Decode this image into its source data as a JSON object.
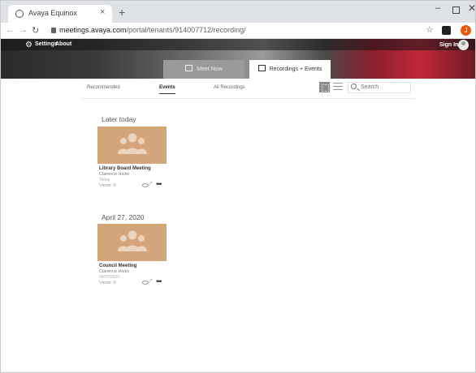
{
  "browser": {
    "tab_title": "Avaya Equinox",
    "close_glyph": "×",
    "new_tab_glyph": "+",
    "url_host": "meetings.avaya.com",
    "url_path": "/portal/tenants/914007712/recording/",
    "profile_initial": "J",
    "min_glyph": "–",
    "close_window_glyph": "✕"
  },
  "header": {
    "settings": "Settings",
    "about": "About",
    "sign_in": "Sign In"
  },
  "main_tabs": [
    {
      "label": "Meet Now"
    },
    {
      "label": "Recordings + Events"
    }
  ],
  "subnav": {
    "tabs": [
      {
        "label": "Recommended"
      },
      {
        "label": "Events"
      },
      {
        "label": "All Recordings"
      }
    ],
    "active": "Events",
    "search_placeholder": "Search"
  },
  "sections": [
    {
      "heading": "Later today",
      "cards": [
        {
          "title": "Library Board Meeting",
          "owner": "Clarence Hicks",
          "date": "Today",
          "views": "Views: 0"
        }
      ]
    },
    {
      "heading": "April 27, 2020",
      "cards": [
        {
          "title": "Council Meeting",
          "owner": "Clarence Hicks",
          "date": "04/27/2020",
          "views": "Views: 0"
        }
      ]
    }
  ],
  "colors": {
    "thumb": "#d4a57a",
    "accent_red": "#c0283a"
  }
}
